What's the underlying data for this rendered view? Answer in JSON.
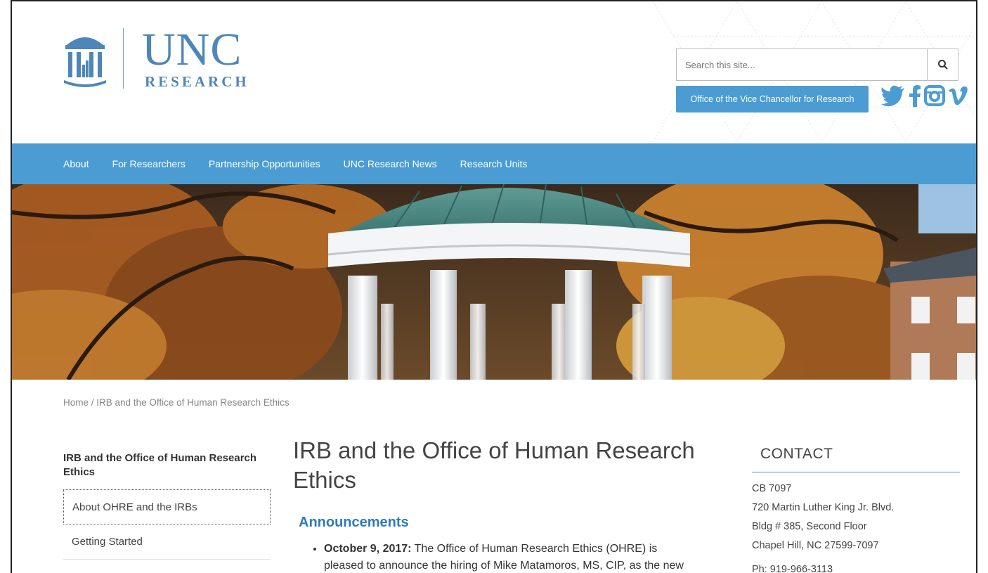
{
  "logo": {
    "unc": "UNC",
    "research": "RESEARCH"
  },
  "search": {
    "placeholder": "Search this site..."
  },
  "header_button": "Office of the Vice Chancellor for Research",
  "social": [
    "twitter-icon",
    "facebook-icon",
    "instagram-icon",
    "vimeo-icon"
  ],
  "nav": [
    "About",
    "For Researchers",
    "Partnership Opportunities",
    "UNC Research News",
    "Research Units"
  ],
  "breadcrumb": {
    "home": "Home",
    "separator": " / ",
    "current": "IRB and the Office of Human Research Ethics"
  },
  "sidebar": {
    "title": "IRB and the Office of Human Research Ethics",
    "items": [
      "About OHRE and the IRBs",
      "Getting Started"
    ]
  },
  "main": {
    "title": "IRB and the Office of Human Research Ethics",
    "announcements_heading": "Announcements",
    "announcement_date": "October 9, 2017:",
    "announcement_text": " The Office of Human Research Ethics (OHRE) is",
    "announcement_text_2": "pleased to announce the hiring of Mike Matamoros, MS, CIP, as the new"
  },
  "contact": {
    "title": "CONTACT",
    "lines": [
      "CB 7097",
      "720 Martin Luther King Jr. Blvd.",
      "Bldg # 385, Second Floor",
      "Chapel Hill, NC 27599-7097"
    ],
    "phone": "Ph: 919-966-3113"
  },
  "colors": {
    "brand_blue": "#4b9cd3",
    "logo_blue": "#4e86b8",
    "heading_blue": "#2f7ab9"
  }
}
